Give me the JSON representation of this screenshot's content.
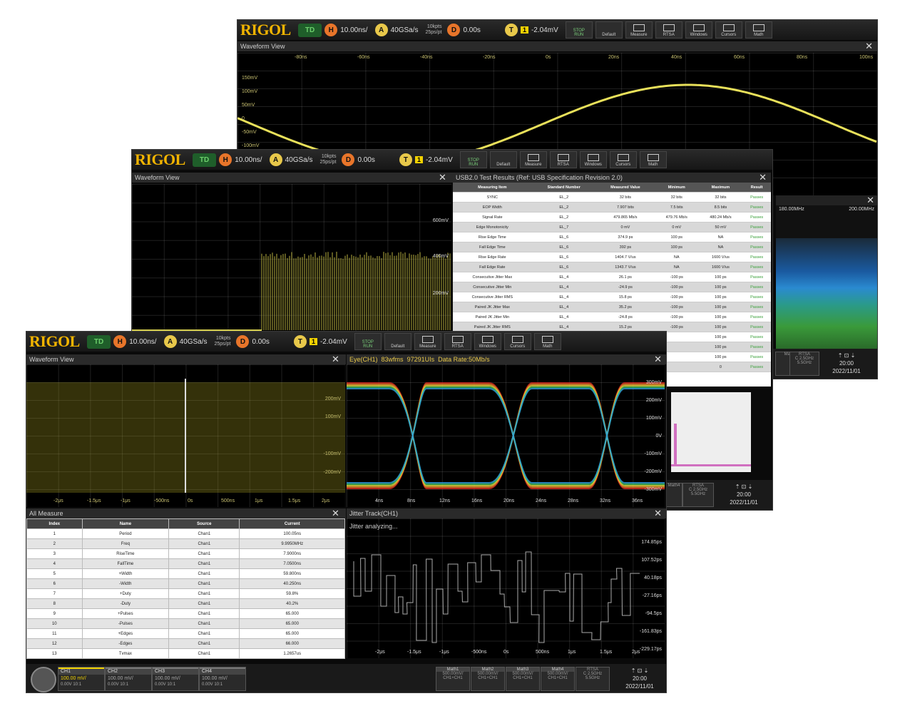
{
  "top_bar": {
    "logo": "RIGOL",
    "mode": "TD",
    "h_label": "H",
    "timebase": "10.00ns/",
    "a_label": "A",
    "sample_rate": "40GSa/s",
    "mem_depth": "10kpts",
    "pts_rate": "25ps/pt",
    "d_label": "D",
    "delay": "0.00s",
    "t_label": "T",
    "trig_ch": "1",
    "trig_level": "-2.04mV",
    "trig_ch_A": "A",
    "stop_run_top": "STOP",
    "stop_run_bottom": "RUN",
    "default": "Default",
    "measure": "Measure",
    "rtsa": "RTSA",
    "windows": "Windows",
    "cursors": "Cursors",
    "math": "Math"
  },
  "back_window": {
    "title": "Waveform View",
    "time_ticks": [
      "-80ns",
      "-60ns",
      "-40ns",
      "-20ns",
      "0s",
      "20ns",
      "40ns",
      "60ns",
      "80ns",
      "100ns"
    ],
    "volt_ticks": [
      "150mV",
      "100mV",
      "50mV",
      "0",
      "-50mV",
      "-100mV"
    ],
    "spectrum_ticks": [
      "180.00MHz",
      "200.00MHz"
    ],
    "rtsa_label": "RTSA",
    "math4": "Math4",
    "rtsa_freq1": "C 2.5GHz",
    "rtsa_freq2": "5.5GHz",
    "time": "20:00",
    "date": "2022/11/01"
  },
  "middle_window": {
    "title": "Waveform View",
    "volt_ticks": [
      "600mV",
      "400mV",
      "200mV"
    ],
    "usb_title": "USB2.0 Test Results (Ref: USB Specification Revision 2.0)",
    "usb_headers": [
      "Measuring Item",
      "Standard Number",
      "Measured Value",
      "Minimum",
      "Maximum",
      "Result"
    ],
    "usb_rows": [
      [
        "SYNC",
        "EL_2",
        "32 bits",
        "32 bits",
        "32 bits",
        "Passes"
      ],
      [
        "EOP Width",
        "EL_2",
        "7.907 bits",
        "7.5 bits",
        "8.5 bits",
        "Passes"
      ],
      [
        "Signal Rate",
        "EL_2",
        "479.865 Mb/s",
        "479.76 Mb/s",
        "480.24 Mb/s",
        "Passes"
      ],
      [
        "Edge Monotonicity",
        "EL_7",
        "0 mV",
        "0 mV",
        "50 mV",
        "Passes"
      ],
      [
        "Rise Edge Time",
        "EL_6",
        "374.9 ps",
        "100 ps",
        "NA",
        "Passes"
      ],
      [
        "Fall Edge Time",
        "EL_6",
        "392 ps",
        "100 ps",
        "NA",
        "Passes"
      ],
      [
        "Rise Edge Rate",
        "EL_6",
        "1404.7 V/us",
        "NA",
        "1600 V/us",
        "Passes"
      ],
      [
        "Fall Edge Rate",
        "EL_6",
        "1343.7 V/us",
        "NA",
        "1600 V/us",
        "Passes"
      ],
      [
        "Consecutive Jitter Max",
        "EL_4",
        "26.1 ps",
        "-100 ps",
        "100 ps",
        "Passes"
      ],
      [
        "Consecutive Jitter Min",
        "EL_4",
        "-24.9 ps",
        "-100 ps",
        "100 ps",
        "Passes"
      ],
      [
        "Consecutive Jitter RMS",
        "EL_4",
        "15.8 ps",
        "-100 ps",
        "100 ps",
        "Passes"
      ],
      [
        "Paired JK Jitter Max",
        "EL_4",
        "35.2 ps",
        "-100 ps",
        "100 ps",
        "Passes"
      ],
      [
        "Paired JK Jitter Min",
        "EL_4",
        "-24.8 ps",
        "-100 ps",
        "100 ps",
        "Passes"
      ],
      [
        "Paired JK Jitter RMS",
        "EL_4",
        "15.2 ps",
        "-100 ps",
        "100 ps",
        "Passes"
      ],
      [
        "",
        "",
        "",
        "",
        "100 ps",
        "Passes"
      ],
      [
        "",
        "",
        "",
        "",
        "100 ps",
        "Passes"
      ],
      [
        "",
        "",
        "",
        "",
        "100 ps",
        "Passes"
      ],
      [
        "",
        "",
        "",
        "",
        "0",
        "Passes"
      ]
    ],
    "math4": "Math4",
    "rtsa_label": "RTSA",
    "rtsa_freq1": "C 2.5GHz",
    "rtsa_freq2": "5.5GHz",
    "time": "20:00",
    "date": "2022/11/01"
  },
  "front_window": {
    "waveform_title": "Waveform View",
    "wave_time_ticks": [
      "-2μs",
      "-1.5μs",
      "-1μs",
      "-500ns",
      "0s",
      "500ns",
      "1μs",
      "1.5μs",
      "2μs"
    ],
    "wave_volt_ticks": [
      "200mV",
      "100mV",
      "-100mV",
      "-200mV"
    ],
    "eye_title": "Eye(CH1)",
    "eye_wfms": "83wfms",
    "eye_uis": "97291UIs",
    "eye_rate": "Data Rate:50Mb/s",
    "eye_volt_ticks": [
      "300mV",
      "200mV",
      "100mV",
      "0V",
      "-100mV",
      "-200mV",
      "-300mV"
    ],
    "eye_time_ticks": [
      "4ns",
      "8ns",
      "12ns",
      "16ns",
      "20ns",
      "24ns",
      "28ns",
      "32ns",
      "36ns"
    ],
    "measure_title": "All Measure",
    "measure_headers": [
      "Index",
      "Name",
      "Source",
      "Current"
    ],
    "measure_rows": [
      [
        "1",
        "Period",
        "Chan1",
        "100.05ns"
      ],
      [
        "2",
        "Freq",
        "Chan1",
        "9.9950MHz"
      ],
      [
        "3",
        "RiseTime",
        "Chan1",
        "7.9000ns"
      ],
      [
        "4",
        "FallTime",
        "Chan1",
        "7.0500ns"
      ],
      [
        "5",
        "+Width",
        "Chan1",
        "59.800ns"
      ],
      [
        "6",
        "-Width",
        "Chan1",
        "40.250ns"
      ],
      [
        "7",
        "+Duty",
        "Chan1",
        "59.8%"
      ],
      [
        "8",
        "-Duty",
        "Chan1",
        "40.2%"
      ],
      [
        "9",
        "+Pulses",
        "Chan1",
        "65.000"
      ],
      [
        "10",
        "-Pulses",
        "Chan1",
        "65.000"
      ],
      [
        "11",
        "+Edges",
        "Chan1",
        "65.000"
      ],
      [
        "12",
        "-Edges",
        "Chan1",
        "66.000"
      ],
      [
        "13",
        "Tvmax",
        "Chan1",
        "1.2657us"
      ]
    ],
    "jitter_title": "Jitter Track(CH1)",
    "jitter_status": "Jitter analyzing...",
    "jitter_volt_ticks": [
      "174.85ps",
      "107.52ps",
      "40.18ps",
      "-27.16ps",
      "-94.5ps",
      "-161.83ps",
      "-229.17ps"
    ],
    "jitter_time_ticks": [
      "-2μs",
      "-1.5μs",
      "-1μs",
      "-500ns",
      "0s",
      "500ns",
      "1μs",
      "1.5μs",
      "2μs"
    ],
    "channels": [
      {
        "name": "CH1",
        "scale": "100.00 mV/",
        "offset": "0.00V",
        "imp": "10:1",
        "color": "#f2d200"
      },
      {
        "name": "CH2",
        "scale": "100.00 mV/",
        "offset": "0.00V",
        "imp": "10:1",
        "color": "#777"
      },
      {
        "name": "CH3",
        "scale": "100.00 mV/",
        "offset": "0.00V",
        "imp": "10:1",
        "color": "#777"
      },
      {
        "name": "CH4",
        "scale": "100.00 mV/",
        "offset": "0.00V",
        "imp": "10:1",
        "color": "#777"
      }
    ],
    "maths": [
      {
        "name": "Math1",
        "v": "500.00mV/",
        "src": "CH1+CH1"
      },
      {
        "name": "Math2",
        "v": "500.00mV/",
        "src": "CH1+CH1"
      },
      {
        "name": "Math3",
        "v": "500.00mV/",
        "src": "CH1+CH1"
      },
      {
        "name": "Math4",
        "v": "500.00mV/",
        "src": "CH1+CH1"
      }
    ],
    "rtsa_label": "RTSA",
    "rtsa_freq1": "C 2.5GHz",
    "rtsa_freq2": "5.5GHz",
    "time": "20:00",
    "date": "2022/11/01"
  }
}
